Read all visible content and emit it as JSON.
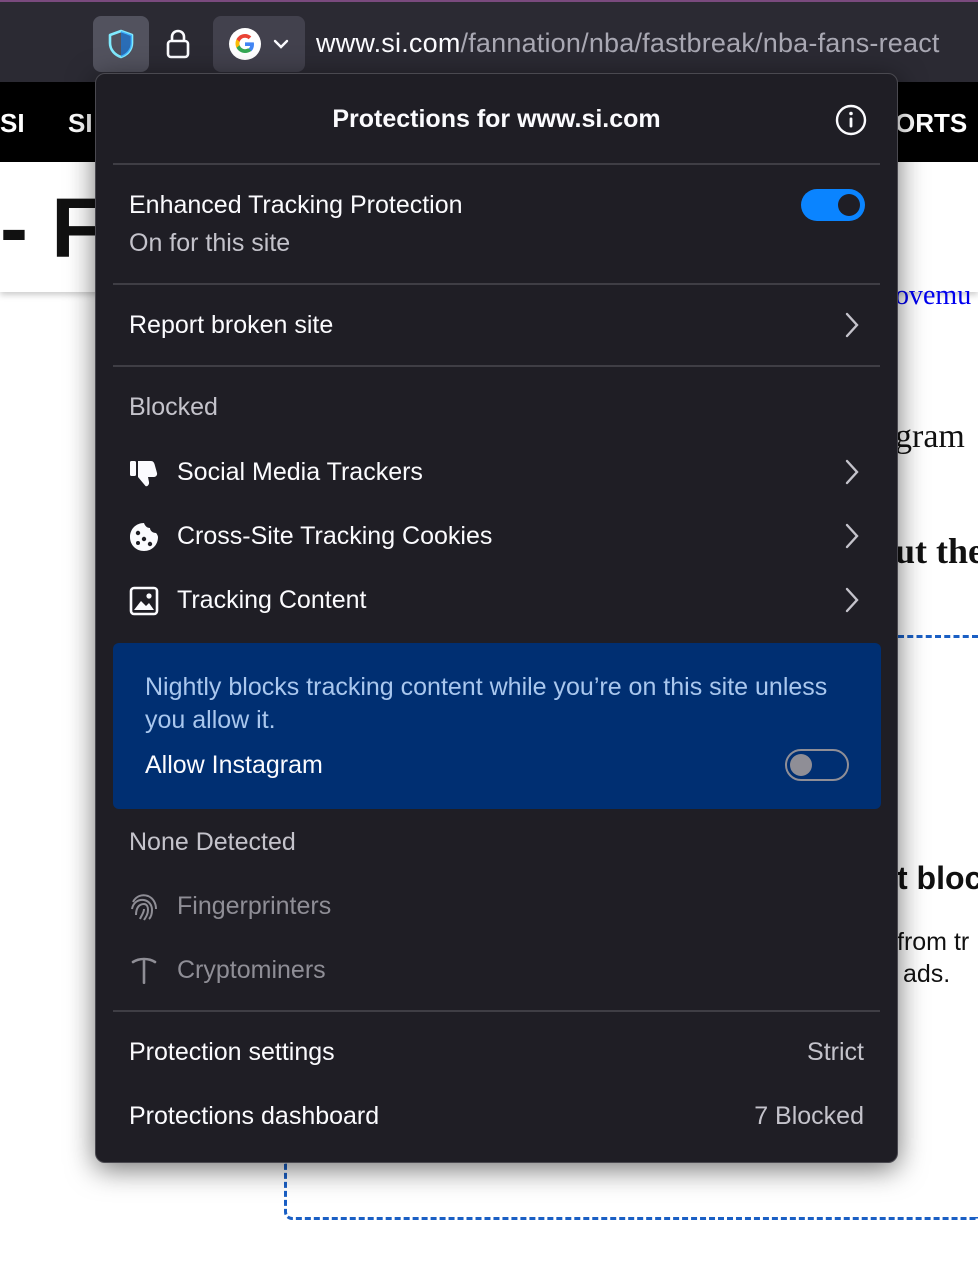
{
  "browser": {
    "url_host": "www.si.com",
    "url_path": "/fannation/nba/fastbreak/nba-fans-react"
  },
  "background_page": {
    "nav_items": [
      "SI",
      "SI",
      "ORTS"
    ],
    "hero_fragment": "- Fa",
    "fragments": [
      "ovemu",
      "gram",
      "ut the",
      "t bloc",
      "from tr",
      "ads."
    ]
  },
  "panel": {
    "title": "Protections for www.si.com",
    "etp": {
      "title": "Enhanced Tracking Protection",
      "status": "On for this site",
      "enabled": true
    },
    "report_broken": "Report broken site",
    "blocked_heading": "Blocked",
    "blocked_items": [
      {
        "label": "Social Media Trackers",
        "icon": "thumbs-down-icon"
      },
      {
        "label": "Cross-Site Tracking Cookies",
        "icon": "cookie-icon"
      },
      {
        "label": "Tracking Content",
        "icon": "image-icon"
      }
    ],
    "info_message": "Nightly blocks tracking content while you’re on this site unless you allow it.",
    "allow_label": "Allow Instagram",
    "allow_enabled": false,
    "none_detected_heading": "None Detected",
    "none_items": [
      {
        "label": "Fingerprinters",
        "icon": "fingerprint-icon"
      },
      {
        "label": "Cryptominers",
        "icon": "pickaxe-icon"
      }
    ],
    "settings_label": "Protection settings",
    "settings_value": "Strict",
    "dashboard_label": "Protections dashboard",
    "dashboard_value": "7 Blocked"
  },
  "colors": {
    "panel_bg": "#1f1e25",
    "accent": "#0a84ff",
    "info_box": "#002f72"
  }
}
